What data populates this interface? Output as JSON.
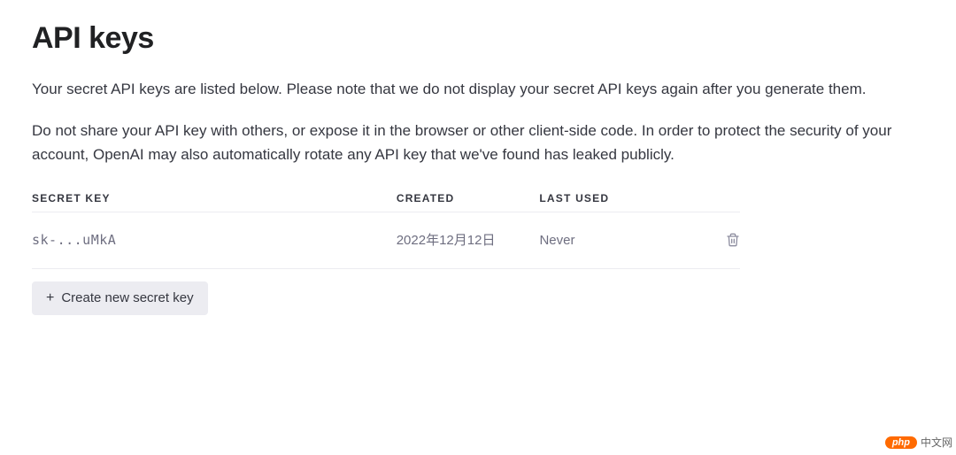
{
  "page": {
    "title": "API keys",
    "description1": "Your secret API keys are listed below. Please note that we do not display your secret API keys again after you generate them.",
    "description2": "Do not share your API key with others, or expose it in the browser or other client-side code. In order to protect the security of your account, OpenAI may also automatically rotate any API key that we've found has leaked publicly."
  },
  "table": {
    "headers": {
      "secret_key": "SECRET KEY",
      "created": "CREATED",
      "last_used": "LAST USED"
    },
    "rows": [
      {
        "key": "sk-...uMkA",
        "created": "2022年12月12日",
        "last_used": "Never"
      }
    ]
  },
  "buttons": {
    "create": "Create new secret key"
  },
  "watermark": {
    "badge": "php",
    "text": "中文网"
  }
}
